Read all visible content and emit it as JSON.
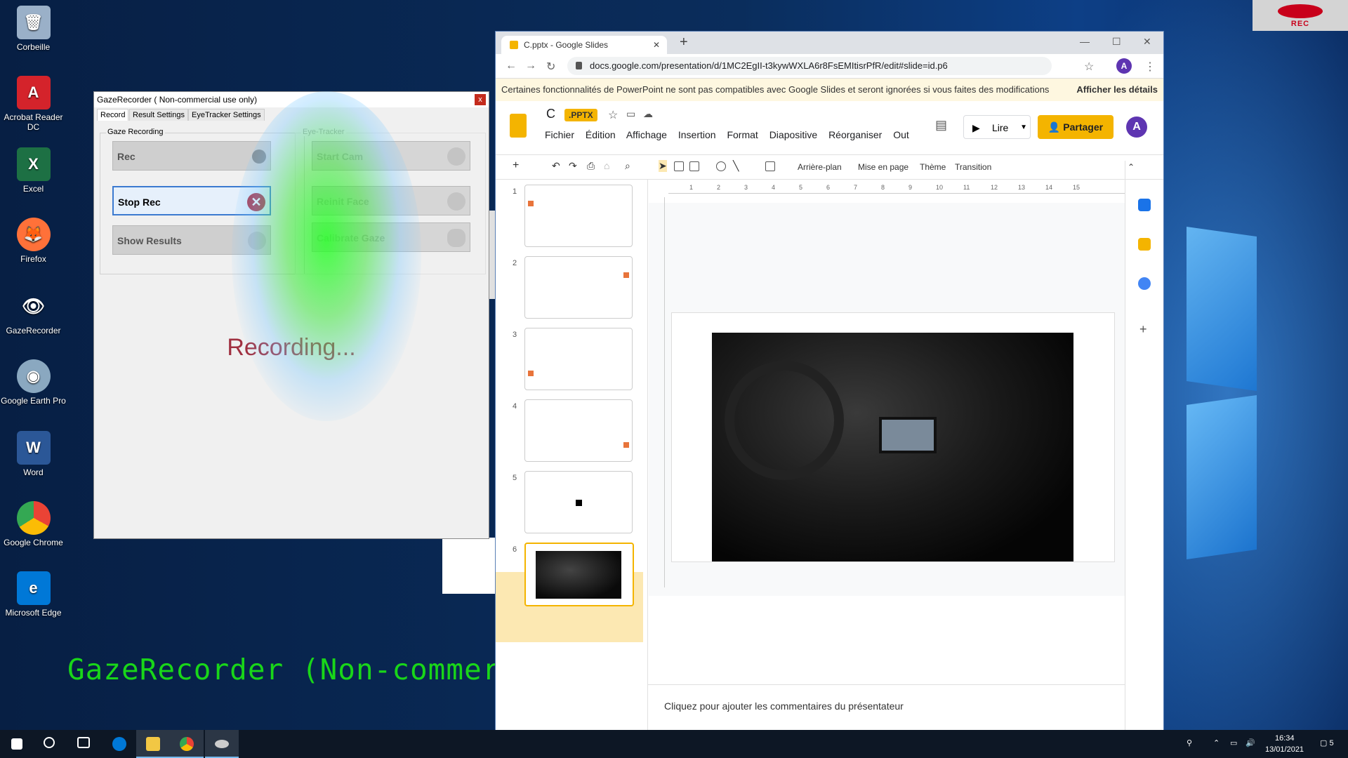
{
  "desktop": {
    "icons": [
      {
        "label": "Corbeille",
        "icon": "recycle-bin-icon",
        "color": "#9ab0c8"
      },
      {
        "label": "Acrobat Reader DC",
        "icon": "acrobat-icon",
        "color": "#d4232b"
      },
      {
        "label": "Excel",
        "icon": "excel-icon",
        "color": "#1d7044"
      },
      {
        "label": "Firefox",
        "icon": "firefox-icon",
        "color": "#ff7139"
      },
      {
        "label": "GazeRecorder",
        "icon": "eye-icon",
        "color": "#cccccc"
      },
      {
        "label": "Google Earth Pro",
        "icon": "earth-icon",
        "color": "#8aa8c0"
      },
      {
        "label": "Word",
        "icon": "word-icon",
        "color": "#2b5797"
      },
      {
        "label": "Google Chrome",
        "icon": "chrome-icon",
        "color": "#34a853"
      },
      {
        "label": "Microsoft Edge",
        "icon": "edge-icon",
        "color": "#0078d7"
      }
    ],
    "rec_badge": "REC",
    "watermark": "GazeRecorder (Non-commercial use only)"
  },
  "gazerecorder": {
    "title": "GazeRecorder   ( Non-commercial use only)",
    "close": "x",
    "tabs": [
      "Record",
      "Result Settings",
      "EyeTracker Settings"
    ],
    "gaze_group": "Gaze Recording",
    "eye_group": "Eye-Tracker",
    "buttons": {
      "rec": "Rec",
      "stop_rec": "Stop Rec",
      "show_results": "Show Results",
      "start_cam": "Start Cam",
      "reinit_face": "Reinit Face",
      "calibrate_gaze": "Calibrate Gaze"
    },
    "status": "Recording..."
  },
  "chrome": {
    "tab_title": "C.pptx - Google Slides",
    "tab_close": "✕",
    "new_tab": "+",
    "url": "docs.google.com/presentation/d/1MC2EgII-t3kywWXLA6r8FsEMItisrPfR/edit#slide=id.p6",
    "avatar": "A",
    "info_text": "Certaines fonctionnalités de PowerPoint ne sont pas compatibles avec Google Slides et seront ignorées si vous faites des modifications",
    "info_link": "Afficher les détails"
  },
  "slides": {
    "doc_title": "C",
    "doc_badge": ".PPTX",
    "menu": [
      "Fichier",
      "Édition",
      "Affichage",
      "Insertion",
      "Format",
      "Diapositive",
      "Réorganiser",
      "Out"
    ],
    "lire": "Lire",
    "share": "Partager",
    "avatar": "A",
    "toolbar": {
      "background": "Arrière-plan",
      "layout": "Mise en page",
      "theme": "Thème",
      "transition": "Transition"
    },
    "ruler_ticks": [
      "1",
      "2",
      "3",
      "4",
      "5",
      "6",
      "7",
      "8",
      "9",
      "10",
      "11",
      "12",
      "13",
      "14",
      "15"
    ],
    "thumbnails": [
      "1",
      "2",
      "3",
      "4",
      "5",
      "6"
    ],
    "selected_slide": 6,
    "notes_placeholder": "Cliquez pour ajouter les commentaires du présentateur"
  },
  "taskbar": {
    "time": "16:34",
    "date": "13/01/2021",
    "notification_count": "5"
  }
}
